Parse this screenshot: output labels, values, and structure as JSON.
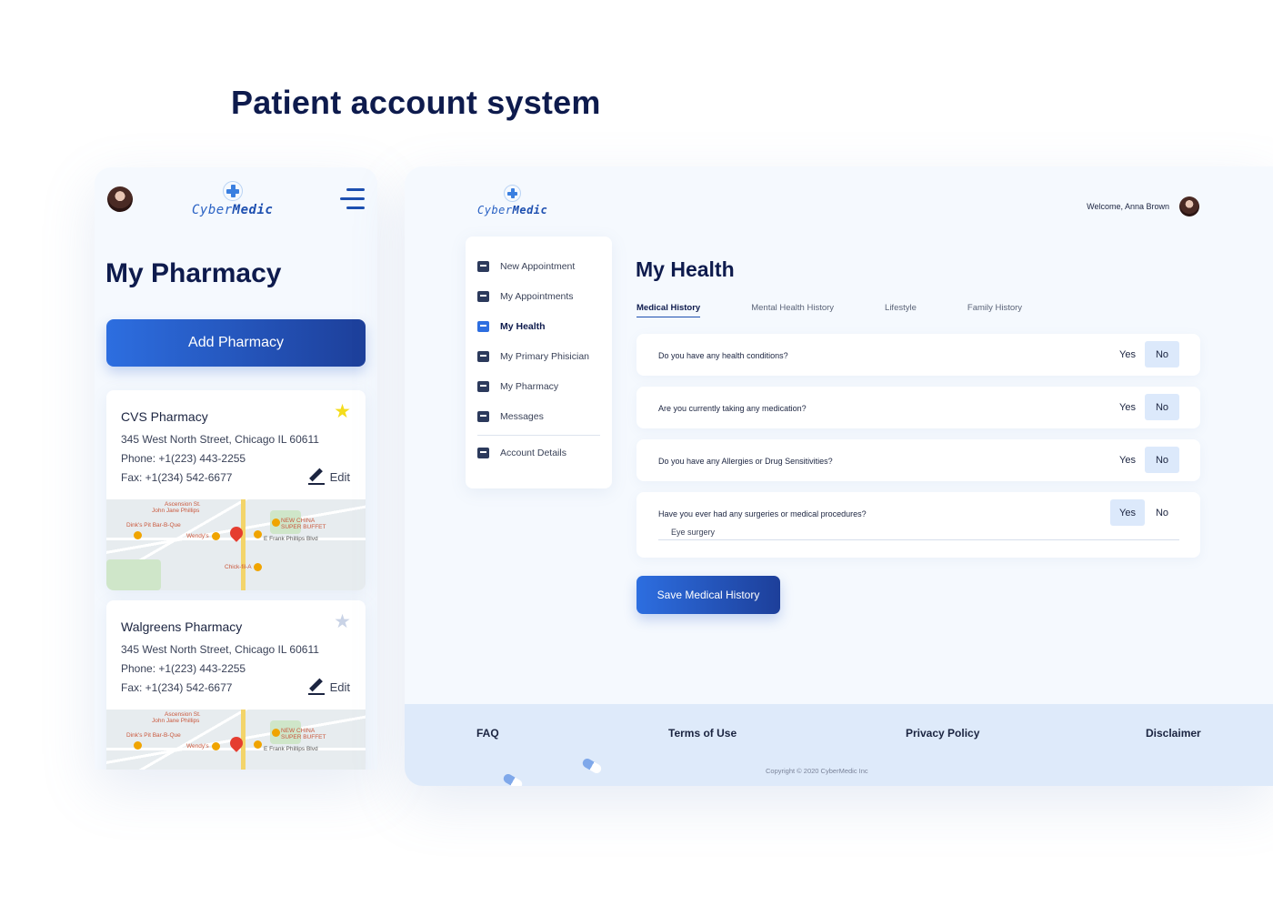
{
  "page": {
    "title": "Patient account system"
  },
  "brand": {
    "name_a": "Cyber",
    "name_b": "Medic"
  },
  "mobile": {
    "title": "My Pharmacy",
    "add_button": "Add Pharmacy",
    "pharmacies": [
      {
        "name": "CVS Pharmacy",
        "address": "345 West North Street, Chicago IL 60611",
        "phone": "Phone: +1(223) 443-2255",
        "fax": "Fax: +1(234) 542-6677",
        "edit": "Edit",
        "favorite": true,
        "map_labels": [
          "Ascension St.",
          "John Jane Phillips",
          "NEW CHINA",
          "SUPER BUFFET",
          "Dink's Pit Bar-B-Que",
          "Wendy's",
          "Chick-fil-A",
          "E Frank Phillips Blvd"
        ]
      },
      {
        "name": "Walgreens Pharmacy",
        "address": "345 West North Street, Chicago IL 60611",
        "phone": "Phone: +1(223) 443-2255",
        "fax": "Fax: +1(234) 542-6677",
        "edit": "Edit",
        "favorite": false,
        "map_labels": [
          "Ascension St.",
          "John Jane Phillips",
          "NEW CHINA",
          "SUPER BUFFET",
          "Dink's Pit Bar-B-Que",
          "Wendy's",
          "E Frank Phillips Blvd"
        ]
      }
    ],
    "star_colors": {
      "active": "#f4dc1c",
      "inactive": "#c9d3e6"
    }
  },
  "desktop": {
    "welcome": "Welcome, Anna Brown",
    "sidebar": [
      {
        "label": "New Appointment",
        "icon": "calendar-icon"
      },
      {
        "label": "My Appointments",
        "icon": "calendar-list-icon"
      },
      {
        "label": "My Health",
        "icon": "health-icon",
        "active": true
      },
      {
        "label": "My Primary Phisician",
        "icon": "doctor-icon"
      },
      {
        "label": "My Pharmacy",
        "icon": "pharmacy-icon"
      },
      {
        "label": "Messages",
        "icon": "message-icon"
      },
      {
        "label": "Account Details",
        "icon": "account-icon"
      }
    ],
    "health_title": "My Health",
    "tabs": [
      "Medical History",
      "Mental Health History",
      "Lifestyle",
      "Family History"
    ],
    "yes_label": "Yes",
    "no_label": "No",
    "questions": [
      {
        "text": "Do you have any health conditions?",
        "answer": "No"
      },
      {
        "text": "Are you currently taking any medication?",
        "answer": "No"
      },
      {
        "text": "Do you have any Allergies or Drug Sensitivities?",
        "answer": "No"
      },
      {
        "text": "Have you ever had any surgeries or medical procedures?",
        "answer": "Yes",
        "detail": "Eye surgery"
      }
    ],
    "save_button": "Save Medical History",
    "footer": {
      "links": [
        "FAQ",
        "Terms of Use",
        "Privacy Policy",
        "Disclaimer"
      ],
      "copyright": "Copyright © 2020 CyberMedic Inc"
    }
  },
  "colors": {
    "primary": "#1d4fb0",
    "accent": "#2d6ee0",
    "navy": "#0e1b4d",
    "selected": "#dce9fb"
  }
}
